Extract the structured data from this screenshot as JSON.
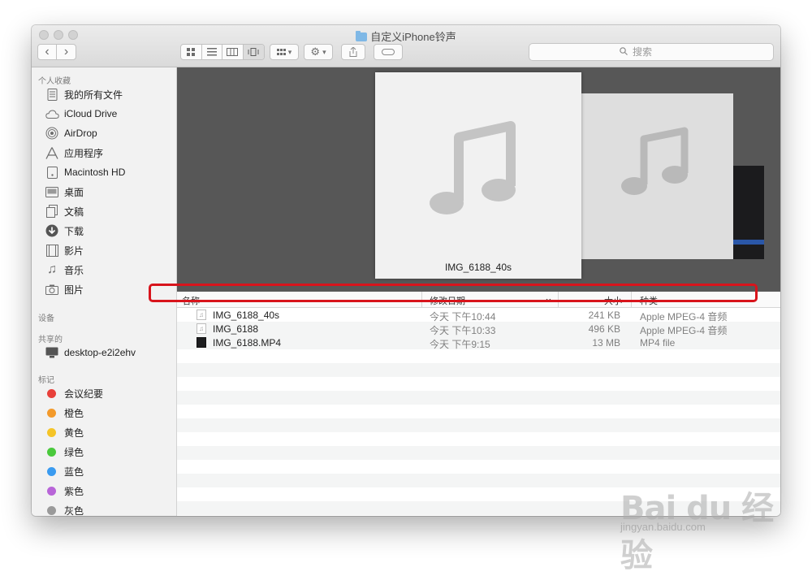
{
  "window": {
    "title": "自定义iPhone铃声"
  },
  "toolbar": {
    "back_glyph": "‹",
    "forward_glyph": "›",
    "view_icons": [
      "grid-icon",
      "list-icon",
      "columns-icon",
      "coverflow-icon"
    ],
    "group_glyph": "▾",
    "action_glyph": "▾"
  },
  "search": {
    "placeholder": "搜索"
  },
  "sidebar": {
    "favorites_header": "个人收藏",
    "favorites": [
      {
        "label": "我的所有文件",
        "icon": "all-files-icon"
      },
      {
        "label": "iCloud Drive",
        "icon": "cloud-icon"
      },
      {
        "label": "AirDrop",
        "icon": "airdrop-icon"
      },
      {
        "label": "应用程序",
        "icon": "applications-icon"
      },
      {
        "label": "Macintosh HD",
        "icon": "disk-icon"
      },
      {
        "label": "桌面",
        "icon": "desktop-icon"
      },
      {
        "label": "文稿",
        "icon": "documents-icon"
      },
      {
        "label": "下载",
        "icon": "download-icon"
      },
      {
        "label": "影片",
        "icon": "movies-icon"
      },
      {
        "label": "音乐",
        "icon": "music-icon"
      },
      {
        "label": "图片",
        "icon": "pictures-icon"
      }
    ],
    "devices_header": "设备",
    "shared_header": "共享的",
    "shared": [
      {
        "label": "desktop-e2i2ehv",
        "icon": "computer-icon"
      }
    ],
    "tags_header": "标记",
    "tags": [
      {
        "label": "会议纪要",
        "color": "#e8403a"
      },
      {
        "label": "橙色",
        "color": "#f39a2b"
      },
      {
        "label": "黄色",
        "color": "#f5c427"
      },
      {
        "label": "绿色",
        "color": "#4ac93c"
      },
      {
        "label": "蓝色",
        "color": "#3a9bf0"
      },
      {
        "label": "紫色",
        "color": "#b865d8"
      },
      {
        "label": "灰色",
        "color": "#9a9a9a"
      }
    ]
  },
  "preview": {
    "caption": "IMG_6188_40s"
  },
  "columns": {
    "name": "名称",
    "date": "修改日期",
    "size": "大小",
    "kind": "种类",
    "sort_glyph": "⌄"
  },
  "files": [
    {
      "name": "IMG_6188_40s",
      "date": "今天 下午10:44",
      "size": "241 KB",
      "kind": "Apple MPEG-4 音频",
      "icon": "audio-file-icon"
    },
    {
      "name": "IMG_6188",
      "date": "今天 下午10:33",
      "size": "496 KB",
      "kind": "Apple MPEG-4 音频",
      "icon": "audio-file-icon"
    },
    {
      "name": "IMG_6188.MP4",
      "date": "今天 下午9:15",
      "size": "13 MB",
      "kind": "MP4 file",
      "icon": "video-file-icon"
    }
  ],
  "watermark": {
    "brand": "Bai du 经验",
    "url": "jingyan.baidu.com"
  },
  "colors": {
    "highlight": "#d8141c",
    "preview_bg": "#575757",
    "sidebar_bg": "#f2f2f2"
  }
}
